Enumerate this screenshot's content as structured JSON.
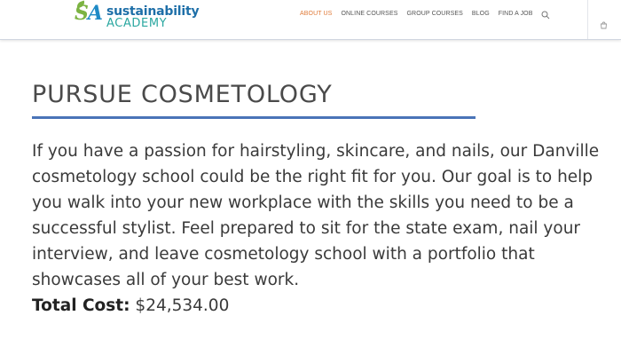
{
  "header": {
    "logo": {
      "mark": "SA",
      "top_text": "sustainability",
      "bottom_text": "ACADEMY"
    },
    "nav": [
      {
        "label": "ABOUT US",
        "active": true
      },
      {
        "label": "ONLINE COURSES",
        "active": false
      },
      {
        "label": "GROUP COURSES",
        "active": false
      },
      {
        "label": "BLOG",
        "active": false
      },
      {
        "label": "FIND A JOB",
        "active": false
      }
    ],
    "search_icon": "search-icon",
    "cart_icon": "cart-icon"
  },
  "main": {
    "title": "PURSUE COSMETOLOGY",
    "intro": "If you have a passion for hairstyling, skincare, and nails, our Danville cosmetology school could be the right fit for you. Our goal is to help you walk into your new workplace with the skills you need to be a successful stylist. Feel prepared to sit for the state exam, nail your interview, and leave cosmetology school with a portfolio that showcases all of your best work.",
    "cost_label": "Total Cost:",
    "cost_value": "$24,534.00"
  },
  "colors": {
    "accent_active": "#e07b3a",
    "title_rule": "#4a74b8",
    "logo_blue": "#1e6fa8",
    "logo_teal": "#2aa7a0",
    "logo_green": "#7cb342"
  }
}
